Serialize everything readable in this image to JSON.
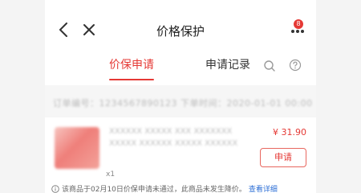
{
  "header": {
    "title": "价格保护",
    "more_badge": "8"
  },
  "tabs": {
    "apply": "价保申请",
    "records": "申请记录"
  },
  "order": {
    "text": "订单编号：1234567890123   下单时间：2020-01-01 00:00"
  },
  "product": {
    "name": "XXXXXX XXXXX XXX XXXXXXX XXXXX XXXXXX XXXXX XXXXXX",
    "price": "¥ 31.90",
    "quantity": "x1",
    "apply_button": "申请"
  },
  "notice": {
    "text": "该商品于02月10日价保申请未通过，此商品未发生降价。",
    "link": "查看详细"
  },
  "colors": {
    "accent": "#e53935",
    "link": "#2d6fd6"
  },
  "icons": [
    "back-icon",
    "close-icon",
    "more-icon",
    "search-icon",
    "help-icon",
    "info-icon"
  ]
}
